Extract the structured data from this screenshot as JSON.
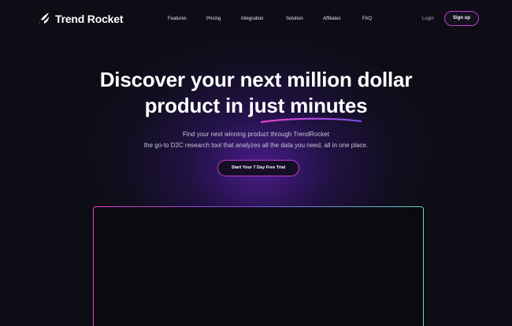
{
  "brand": {
    "name": "Trend Rocket",
    "logo_icon": "rocket-swoosh-icon"
  },
  "nav": {
    "items": [
      {
        "label": "Features"
      },
      {
        "label": "Pricing"
      },
      {
        "label": "Integration"
      },
      {
        "label": "Solution"
      },
      {
        "label": "Affiliates"
      },
      {
        "label": "FAQ"
      }
    ],
    "login_label": "Login",
    "signup_label": "Sign up"
  },
  "hero": {
    "headline_line1": "Discover your next million dollar",
    "headline_line2": "product in just minutes",
    "subtext_line1": "Find your next winning product through TrendRocket",
    "subtext_line2": "the go-to D2C research tool that analyzes all the data you need, all in one place.",
    "cta_label": "Start Your 7 Day Free Trial"
  },
  "colors": {
    "background": "#0e0d16",
    "accent_pink": "#c53dcf",
    "accent_purple": "#7b4de8",
    "accent_teal": "#5fd8d0",
    "glow_purple": "#6e23c8"
  }
}
